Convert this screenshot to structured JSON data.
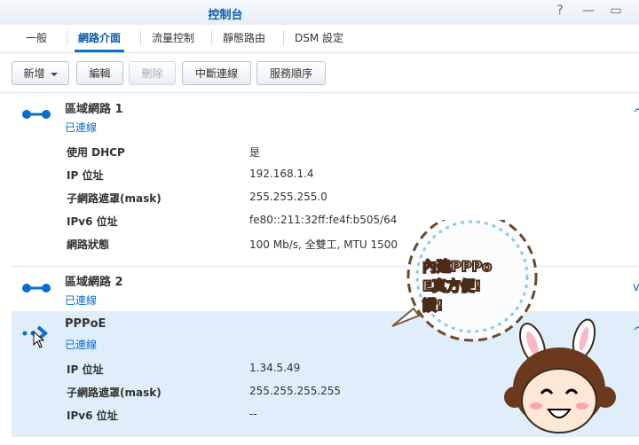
{
  "window": {
    "title": "控制台",
    "help": "?",
    "minimize": "—",
    "maximize": "▭"
  },
  "tabs": [
    "一般",
    "網路介面",
    "流量控制",
    "靜態路由",
    "DSM 設定"
  ],
  "toolbar": {
    "create": "新增",
    "edit": "編輯",
    "delete": "刪除",
    "disconnect": "中斷連線",
    "service_order": "服務順序"
  },
  "interfaces": [
    {
      "name": "區域網路 1",
      "status": "已連線",
      "rows": [
        {
          "label": "使用 DHCP",
          "value": "是"
        },
        {
          "label": "IP 位址",
          "value": "192.168.1.4"
        },
        {
          "label": "子網路遮罩(mask)",
          "value": "255.255.255.0"
        },
        {
          "label": "IPv6 位址",
          "value": "fe80::211:32ff:fe4f:b505/64"
        },
        {
          "label": "網路狀態",
          "value": "100 Mb/s, 全雙工, MTU 1500"
        }
      ]
    },
    {
      "name": "區域網路 2",
      "status": "已連線"
    },
    {
      "name": "PPPoE",
      "status": "已連線",
      "rows": [
        {
          "label": "IP 位址",
          "value": "1.34.5.49"
        },
        {
          "label": "子網路遮罩(mask)",
          "value": "255.255.255.255"
        },
        {
          "label": "IPv6 位址",
          "value": "--"
        }
      ]
    }
  ],
  "sticker": {
    "line1": "內建PPPo",
    "line2": "E真方便!",
    "line3": "讚!"
  },
  "colors": {
    "accent": "#0a6ccc",
    "selected_bg": "#dfeefa"
  }
}
